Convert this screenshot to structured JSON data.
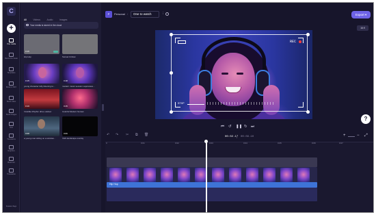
{
  "rail": {
    "logo": "C",
    "add": "+",
    "items": [
      {
        "label": "Your media",
        "icon": "media-icon"
      },
      {
        "label": "Record & create",
        "icon": "record-icon"
      },
      {
        "label": "Templates",
        "icon": "templates-icon"
      },
      {
        "label": "Music & SFX",
        "icon": "music-icon"
      },
      {
        "label": "Stock video",
        "icon": "stock-video-icon"
      },
      {
        "label": "Stock images",
        "icon": "stock-images-icon"
      },
      {
        "label": "Text",
        "icon": "text-icon"
      },
      {
        "label": "Transitions",
        "icon": "transitions-icon"
      },
      {
        "label": "Graphics",
        "icon": "graphics-icon"
      },
      {
        "label": "Brand kit",
        "icon": "brand-kit-icon"
      },
      {
        "label": "Translation",
        "icon": "translation-icon"
      }
    ],
    "bottom": "Feature flags"
  },
  "library": {
    "tabs": [
      "All",
      "Videos",
      "Audio",
      "Images"
    ],
    "notice": "Your media is stored in the cloud",
    "items": [
      {
        "duration": "0:15",
        "caption": "Hip Hop"
      },
      {
        "duration": "",
        "caption": "Sunset Cricket"
      },
      {
        "duration": "0:15",
        "caption": "young character lofty listening to..."
      },
      {
        "duration": "0:18",
        "caption": "modern music session vaporwave..."
      },
      {
        "duration": "0:19",
        "caption": "Invisible Rhythm drive outdoor"
      },
      {
        "duration": "0:15",
        "caption": "Colorful Modern Sunset"
      },
      {
        "duration": "0:08",
        "caption": "a young man sitting on a window..."
      },
      {
        "duration": "0:06",
        "caption": "VHS landscape overlay"
      }
    ]
  },
  "topbar": {
    "project_badge": "P",
    "project_name": "Personal",
    "separator": "/",
    "title": "One to watch",
    "more": "⋮",
    "export_label": "Export",
    "aspect_label": "16:9"
  },
  "preview": {
    "rec_label": "REC",
    "stop_label": "STOP"
  },
  "playback": {
    "skip_back": "⏮",
    "rewind": "↺",
    "play_pause": "❚❚",
    "forward": "↻",
    "skip_forward": "⏭",
    "time_current": "00:02.17",
    "time_separator": "/",
    "time_total": "00:09.10"
  },
  "timeline": {
    "tools": [
      "↶",
      "↷",
      "✂",
      "⧉",
      "🗑"
    ],
    "ticks": [
      "0",
      "0:01",
      "0:02",
      "0:03",
      "0:04",
      "0:05",
      "0:06",
      "0:07",
      "0:08",
      "0:09",
      "0:10"
    ],
    "audio_track_label": "Hip Hop",
    "zoom_in": "+",
    "zoom_out": "−",
    "fit": "⤢"
  },
  "help": "?",
  "colors": {
    "accent": "#6e63e6",
    "background": "#17152b",
    "audio_track": "#3e73d6"
  }
}
